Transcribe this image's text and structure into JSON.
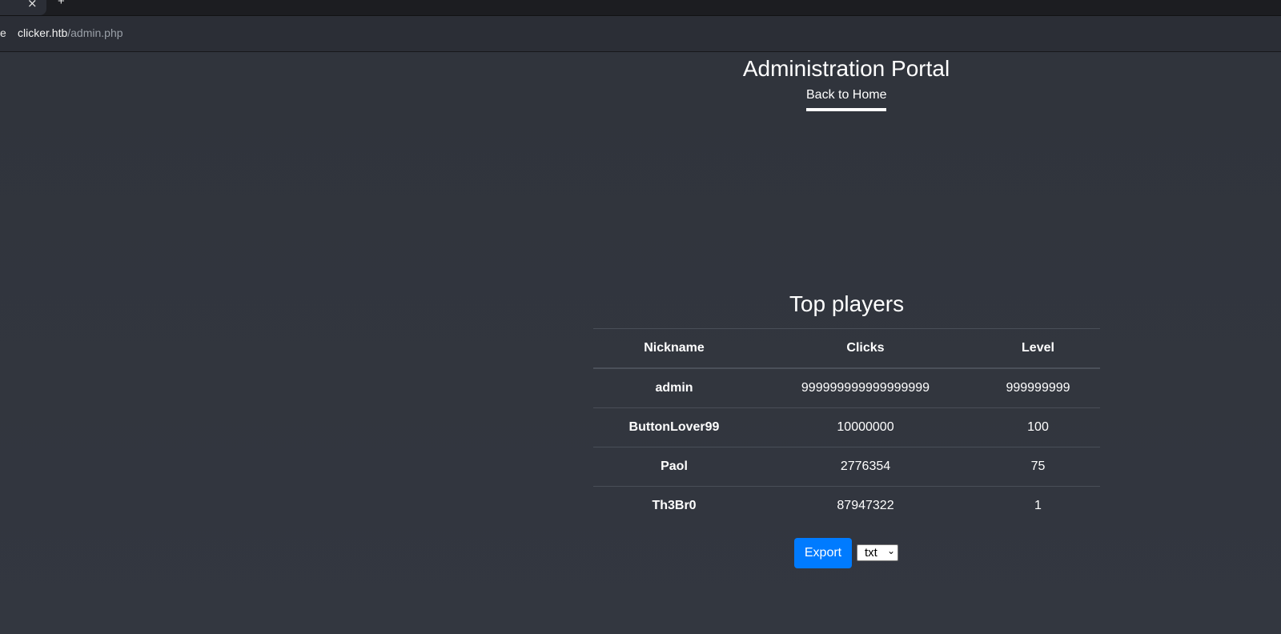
{
  "browser": {
    "url_leading": "e",
    "url_host": "clicker.htb",
    "url_path": "/admin.php",
    "tab_close_glyph": "×",
    "new_tab_glyph": "+"
  },
  "header": {
    "title": "Administration Portal",
    "home_link": "Back to Home"
  },
  "players": {
    "title": "Top players",
    "columns": [
      "Nickname",
      "Clicks",
      "Level"
    ],
    "rows": [
      {
        "nickname": "admin",
        "clicks": "999999999999999999",
        "level": "999999999"
      },
      {
        "nickname": "ButtonLover99",
        "clicks": "10000000",
        "level": "100"
      },
      {
        "nickname": "Paol",
        "clicks": "2776354",
        "level": "75"
      },
      {
        "nickname": "Th3Br0",
        "clicks": "87947322",
        "level": "1"
      }
    ]
  },
  "export": {
    "button_label": "Export",
    "format_value": "txt",
    "format_caret": "⌄"
  },
  "colors": {
    "background": "#30343c",
    "accent": "#007bff",
    "text": "#ffffff"
  }
}
